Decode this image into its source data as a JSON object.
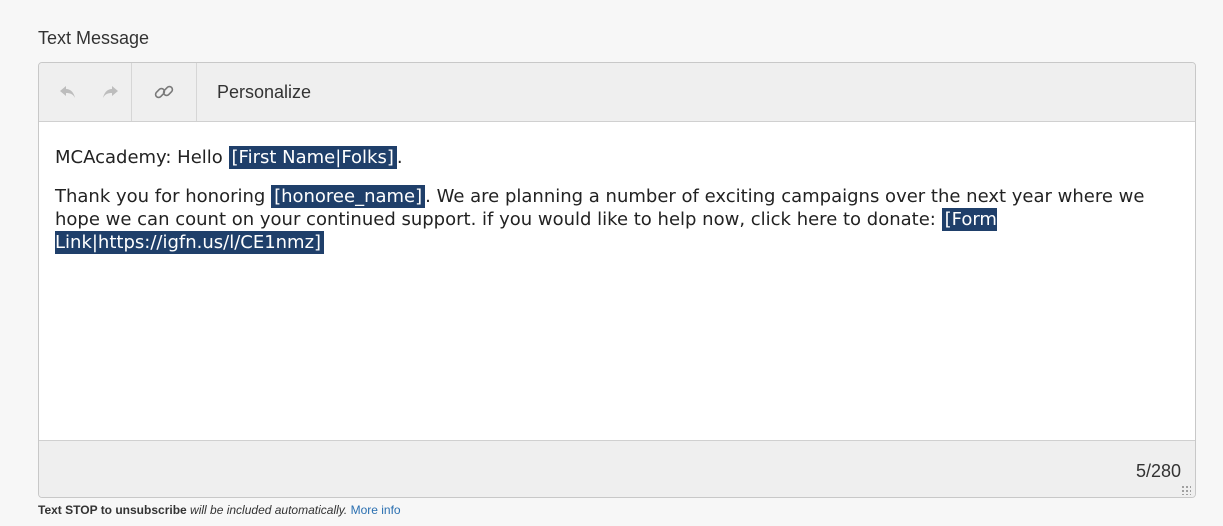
{
  "section": {
    "label": "Text Message"
  },
  "toolbar": {
    "undo_icon": "undo-arrow-icon",
    "redo_icon": "redo-arrow-icon",
    "link_icon": "link-chain-icon",
    "personalize_label": "Personalize"
  },
  "message": {
    "line1_prefix": "MCAcademy: Hello ",
    "line1_token": "[First Name|Folks]",
    "line1_suffix": ".",
    "para2_prefix": "Thank you for honoring ",
    "para2_token1": "[honoree_name]",
    "para2_middle": ". We are planning a number of exciting campaigns over the next year where we hope we can count on your continued support. if you would like to help now, click here to donate: ",
    "para2_token2": "[Form Link|https://igfn.us/l/CE1nmz]"
  },
  "footer": {
    "counter": "5/280"
  },
  "note": {
    "bold": "Text STOP to unsubscribe",
    "italic": " will be included automatically.",
    "link": "More info"
  },
  "colors": {
    "token_bg": "#1f3f6a",
    "link": "#2a6fb0"
  }
}
